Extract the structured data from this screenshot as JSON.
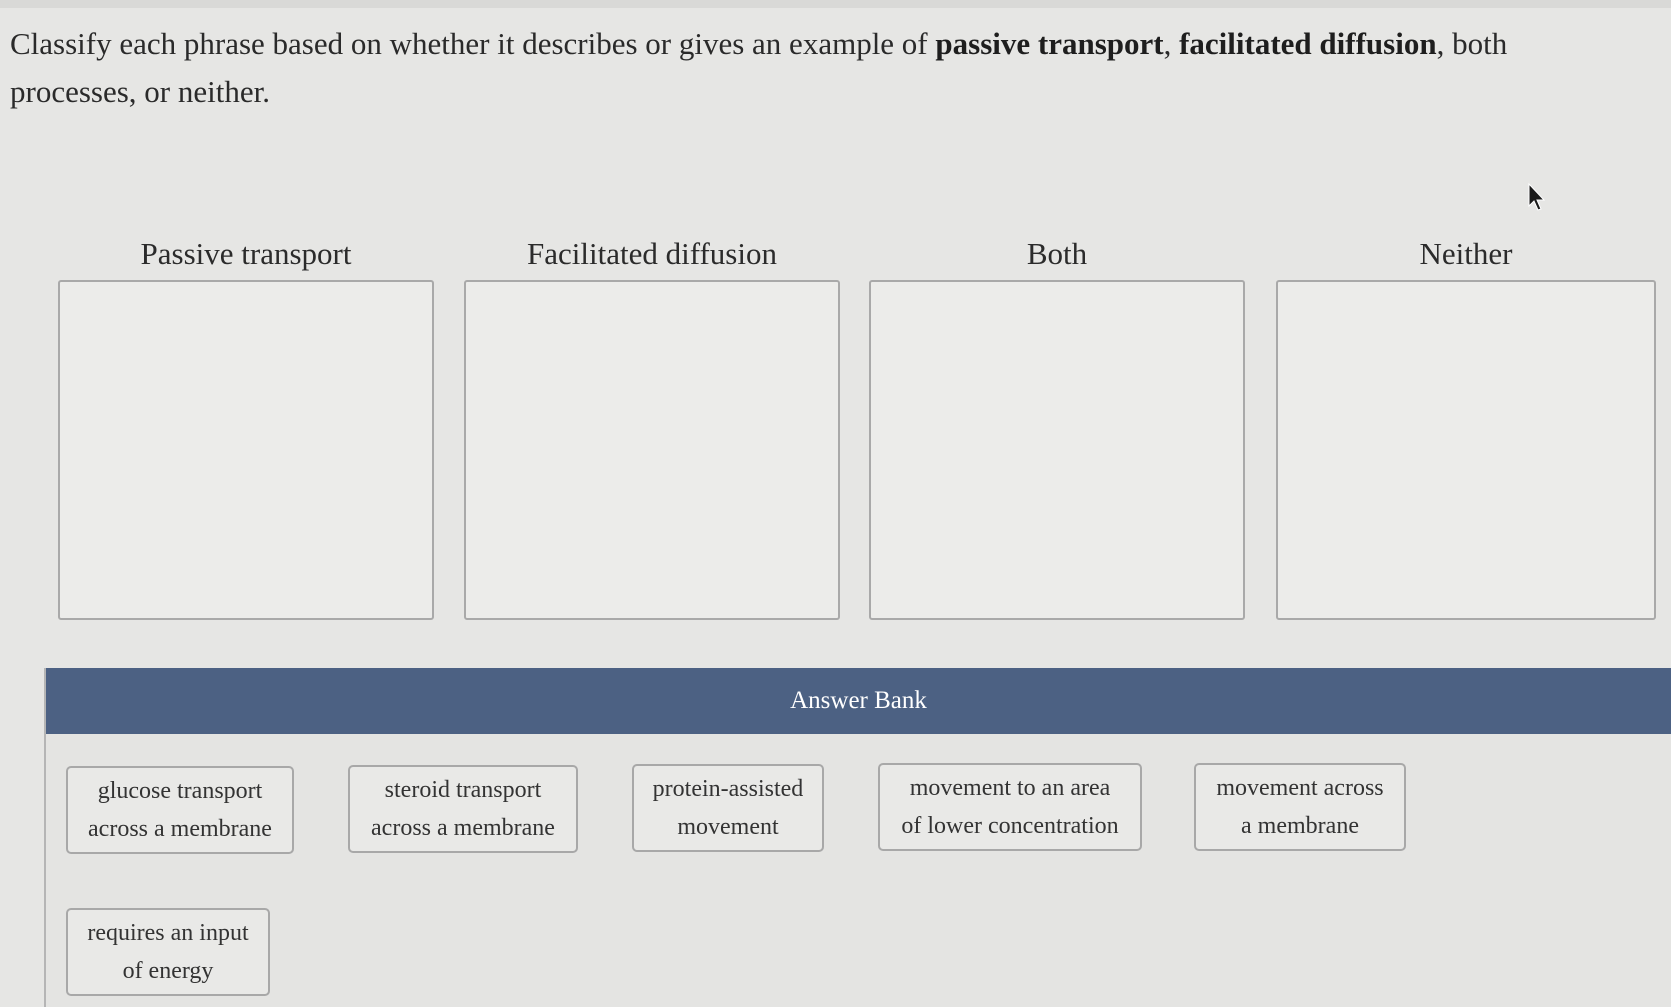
{
  "prompt": {
    "before": "Classify each phrase based on whether it describes or gives an example of ",
    "term1": "passive transport",
    "sep": ", ",
    "term2": "facilitated diffusion",
    "after": ", both processes, or neither."
  },
  "bins": [
    {
      "label": "Passive transport"
    },
    {
      "label": "Facilitated diffusion"
    },
    {
      "label": "Both"
    },
    {
      "label": "Neither"
    }
  ],
  "answer_bank": {
    "title": "Answer Bank",
    "items": [
      {
        "line1": "glucose transport",
        "line2": "across a membrane"
      },
      {
        "line1": "steroid transport",
        "line2": "across a membrane"
      },
      {
        "line1": "protein-assisted",
        "line2": "movement"
      },
      {
        "line1": "movement to an area",
        "line2": "of lower concentration"
      },
      {
        "line1": "movement across",
        "line2": "a membrane"
      },
      {
        "line1": "requires an input",
        "line2": "of energy"
      }
    ]
  },
  "colors": {
    "bank_header": "#4c6183",
    "background": "#e6e6e4"
  },
  "icons": {
    "cursor": "mouse-pointer-icon"
  }
}
